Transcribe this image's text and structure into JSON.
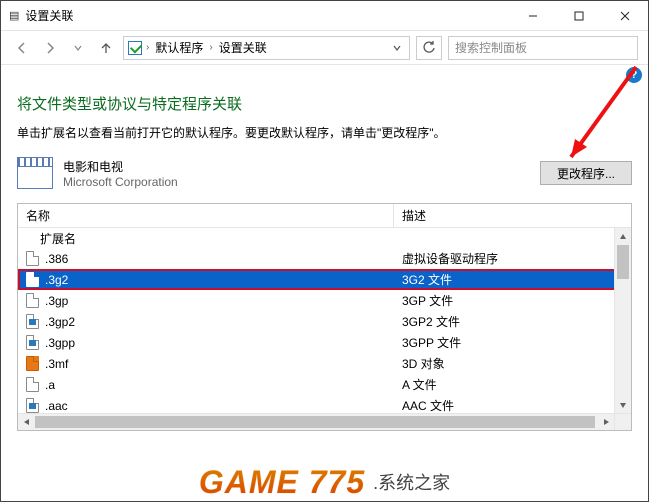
{
  "titlebar": {
    "title": "设置关联"
  },
  "nav": {
    "crumb1": "默认程序",
    "crumb2": "设置关联",
    "search_placeholder": "搜索控制面板"
  },
  "content": {
    "heading": "将文件类型或协议与特定程序关联",
    "subtext": "单击扩展名以查看当前打开它的默认程序。要更改默认程序，请单击\"更改程序\"。",
    "program_name": "电影和电视",
    "program_corp": "Microsoft Corporation",
    "change_btn": "更改程序..."
  },
  "table": {
    "col_name": "名称",
    "col_desc": "描述",
    "group": "扩展名",
    "rows": [
      {
        "ext": ".386",
        "desc": "虚拟设备驱动程序",
        "selected": false,
        "icon": "page"
      },
      {
        "ext": ".3g2",
        "desc": "3G2 文件",
        "selected": true,
        "icon": "page"
      },
      {
        "ext": ".3gp",
        "desc": "3GP 文件",
        "selected": false,
        "icon": "page"
      },
      {
        "ext": ".3gp2",
        "desc": "3GP2 文件",
        "selected": false,
        "icon": "blue"
      },
      {
        "ext": ".3gpp",
        "desc": "3GPP 文件",
        "selected": false,
        "icon": "blue"
      },
      {
        "ext": ".3mf",
        "desc": "3D 对象",
        "selected": false,
        "icon": "orange"
      },
      {
        "ext": ".a",
        "desc": "A 文件",
        "selected": false,
        "icon": "page"
      },
      {
        "ext": ".aac",
        "desc": "AAC 文件",
        "selected": false,
        "icon": "blue"
      }
    ]
  },
  "watermark": {
    "logo": "GAME 775",
    "site": ".系统之家"
  }
}
